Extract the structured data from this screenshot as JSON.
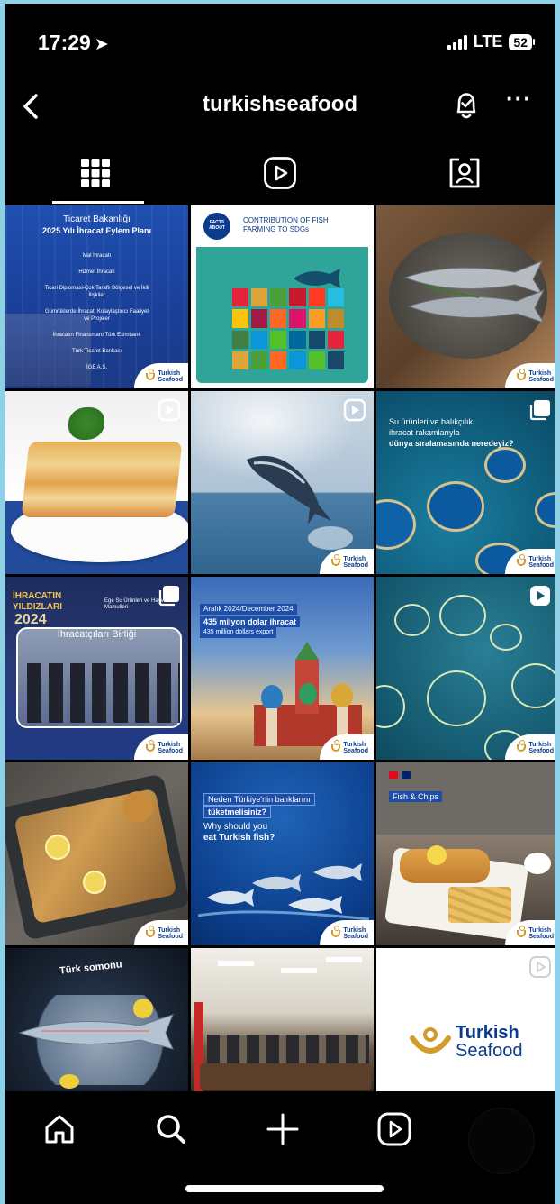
{
  "status_bar": {
    "time": "17:29",
    "network": "LTE",
    "battery": "52"
  },
  "header": {
    "title": "turkishseafood",
    "back_icon": "chevron-left-icon",
    "notify_icon": "bell-check-icon",
    "more_icon": "more-horizontal-icon",
    "more_glyph": "···"
  },
  "tabs": [
    {
      "name": "grid-icon",
      "active": true
    },
    {
      "name": "reels-icon",
      "active": false
    },
    {
      "name": "tagged-icon",
      "active": false
    }
  ],
  "brand": {
    "logo_line1": "Turkish",
    "logo_line2": "Seafood",
    "blue": "#0b3b8c",
    "gold": "#d39b2a"
  },
  "posts": [
    {
      "id": "p1",
      "title_line1": "Ticaret Bakanlığı",
      "title_line2": "2025 Yılı İhracat Eylem Planı",
      "items": [
        "Mal İhracatı",
        "Hizmet İhracatı",
        "Ticari Diplomasi-Çok Taraflı Bölgesel ve İkili İlişkiler",
        "Gümrüklerde İhracatı Kolaylaştırıcı Faaliyet ve Projeler",
        "İhracatın Finansmanı Türk Eximbank",
        "Türk Ticaret Bankası",
        "İGE A.Ş."
      ]
    },
    {
      "id": "p2",
      "badge": "FACTS ABOUT",
      "title": "CONTRIBUTION OF FISH FARMING TO SDGs"
    },
    {
      "id": "p3"
    },
    {
      "id": "p4",
      "type": "reel"
    },
    {
      "id": "p5",
      "type": "reel"
    },
    {
      "id": "p6",
      "type": "carousel",
      "line1": "Su ürünleri ve balıkçılık",
      "line2": "ihracat rakamlarıyla",
      "line3": "dünya sıralamasında neredeyiz?"
    },
    {
      "id": "p7",
      "type": "carousel",
      "line1": "İHRACATIN",
      "line2": "YILDIZLARI",
      "line3": "2024",
      "sub": "Ege Su Ürünleri ve Hayvansal Mamulleri",
      "banner": "İhracatçıları Birliği"
    },
    {
      "id": "p8",
      "line1": "Aralık 2024/December 2024",
      "line2": "435 milyon dolar ihracat",
      "line3": "435 million dollars export"
    },
    {
      "id": "p9",
      "type": "reel"
    },
    {
      "id": "p10"
    },
    {
      "id": "p11",
      "line1": "Neden Türkiye'nin balıklarını",
      "line2": "tüketmelisiniz?",
      "line3": "Why should you",
      "line4": "eat Turkish fish?"
    },
    {
      "id": "p12",
      "line1": "Fish & Chips"
    },
    {
      "id": "p13",
      "line1": "Türk somonu"
    },
    {
      "id": "p14"
    },
    {
      "id": "p15",
      "type": "reel",
      "logo_line1": "Turkish",
      "logo_line2": "Seafood"
    }
  ],
  "bottom_nav": [
    "home-icon",
    "search-icon",
    "create-icon",
    "reels-icon",
    "profile-avatar"
  ]
}
